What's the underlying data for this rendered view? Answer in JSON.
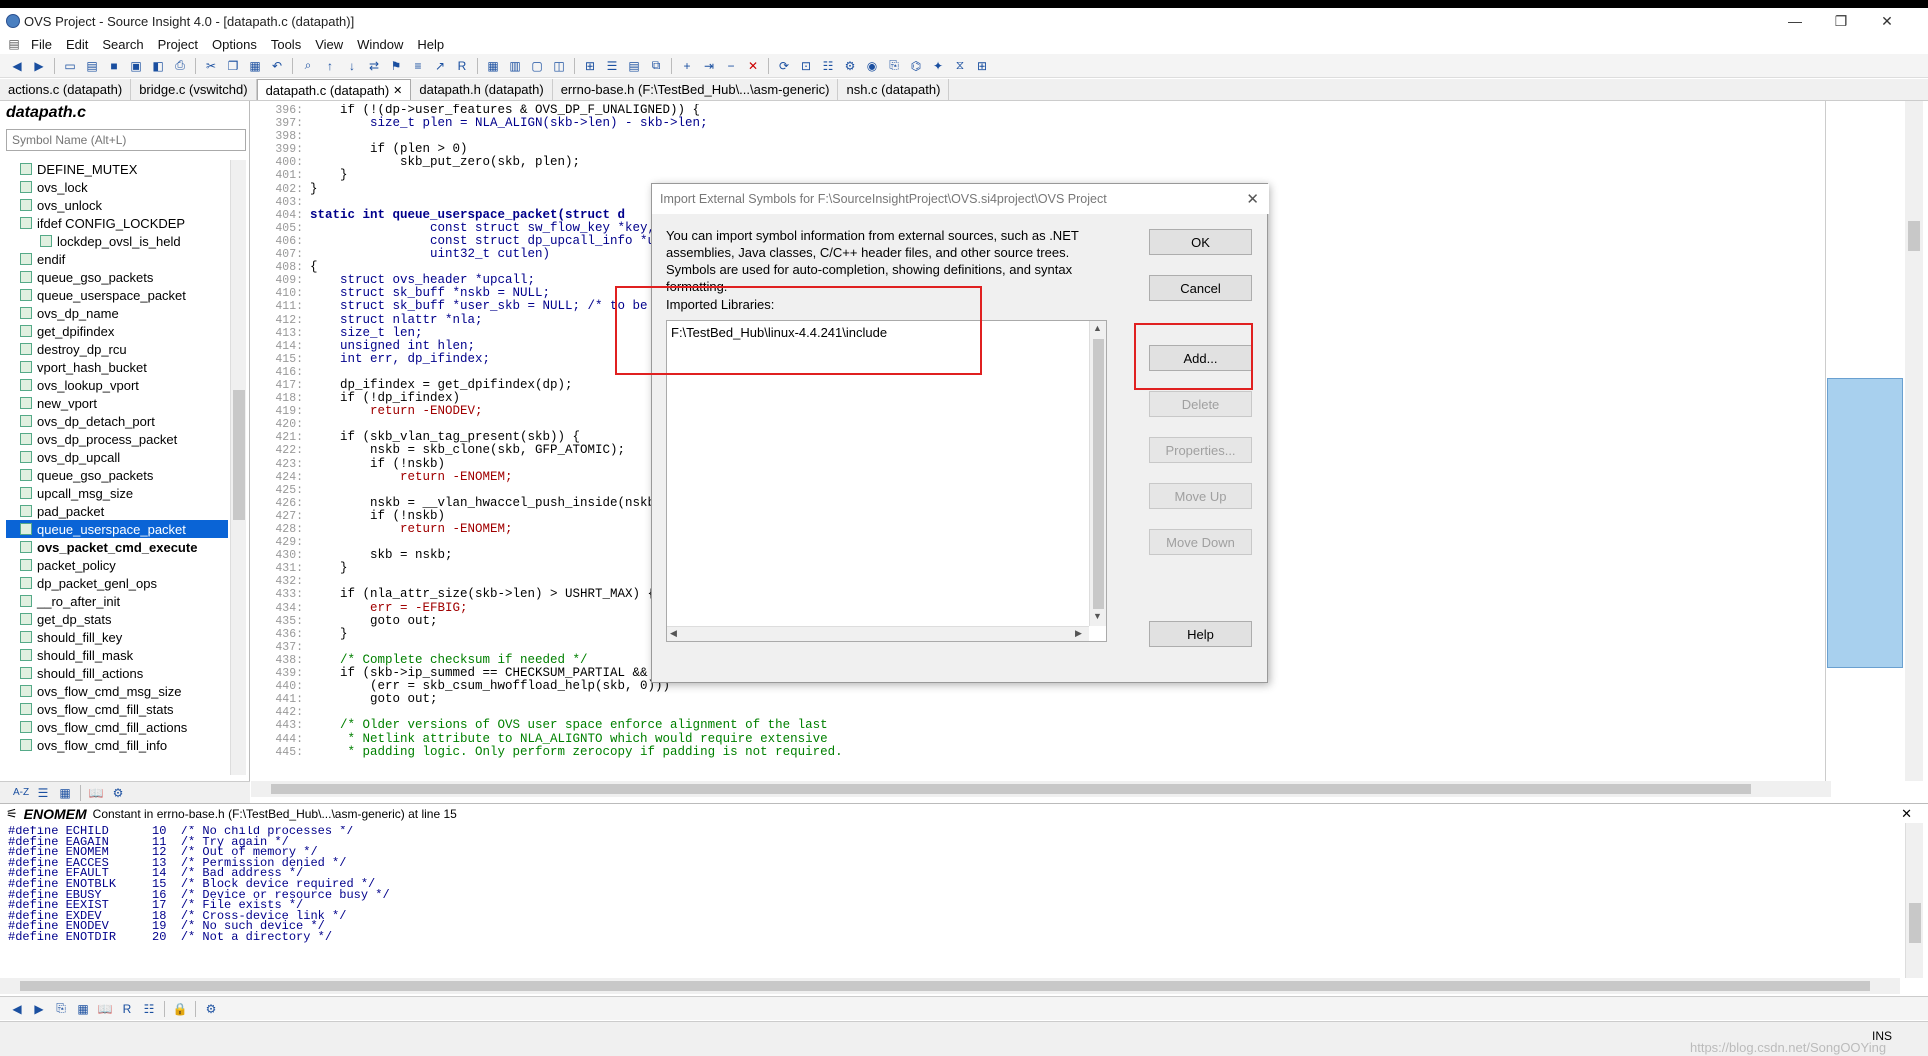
{
  "window": {
    "title": "OVS Project - Source Insight 4.0 - [datapath.c (datapath)]",
    "min": "—",
    "restore": "❐",
    "close": "✕"
  },
  "menu": [
    "File",
    "Edit",
    "Search",
    "Project",
    "Options",
    "Tools",
    "View",
    "Window",
    "Help"
  ],
  "tabs": [
    {
      "label": "actions.c (datapath)",
      "active": false
    },
    {
      "label": "bridge.c (vswitchd)",
      "active": false
    },
    {
      "label": "datapath.c (datapath)",
      "active": true
    },
    {
      "label": "datapath.h (datapath)",
      "active": false
    },
    {
      "label": "errno-base.h (F:\\TestBed_Hub\\...\\asm-generic)",
      "active": false
    },
    {
      "label": "nsh.c (datapath)",
      "active": false
    }
  ],
  "symbol_panel": {
    "title": "datapath.c",
    "search_placeholder": "Symbol Name (Alt+L)",
    "items": [
      {
        "label": "DEFINE_MUTEX",
        "sel": false,
        "bold": false
      },
      {
        "label": "ovs_lock",
        "sel": false,
        "bold": false
      },
      {
        "label": "ovs_unlock",
        "sel": false,
        "bold": false
      },
      {
        "label": "ifdef CONFIG_LOCKDEP",
        "sel": false,
        "bold": false
      },
      {
        "label": "lockdep_ovsl_is_held",
        "sel": false,
        "bold": false
      },
      {
        "label": "endif",
        "sel": false,
        "bold": false
      },
      {
        "label": "queue_gso_packets",
        "sel": false,
        "bold": false
      },
      {
        "label": "queue_userspace_packet",
        "sel": false,
        "bold": false
      },
      {
        "label": "ovs_dp_name",
        "sel": false,
        "bold": false
      },
      {
        "label": "get_dpifindex",
        "sel": false,
        "bold": false
      },
      {
        "label": "destroy_dp_rcu",
        "sel": false,
        "bold": false
      },
      {
        "label": "vport_hash_bucket",
        "sel": false,
        "bold": false
      },
      {
        "label": "ovs_lookup_vport",
        "sel": false,
        "bold": false
      },
      {
        "label": "new_vport",
        "sel": false,
        "bold": false
      },
      {
        "label": "ovs_dp_detach_port",
        "sel": false,
        "bold": false
      },
      {
        "label": "ovs_dp_process_packet",
        "sel": false,
        "bold": false
      },
      {
        "label": "ovs_dp_upcall",
        "sel": false,
        "bold": false
      },
      {
        "label": "queue_gso_packets",
        "sel": false,
        "bold": false
      },
      {
        "label": "upcall_msg_size",
        "sel": false,
        "bold": false
      },
      {
        "label": "pad_packet",
        "sel": false,
        "bold": false
      },
      {
        "label": "queue_userspace_packet",
        "sel": true,
        "bold": false
      },
      {
        "label": "ovs_packet_cmd_execute",
        "sel": false,
        "bold": true
      },
      {
        "label": "packet_policy",
        "sel": false,
        "bold": false
      },
      {
        "label": "dp_packet_genl_ops",
        "sel": false,
        "bold": false
      },
      {
        "label": "__ro_after_init",
        "sel": false,
        "bold": false
      },
      {
        "label": "get_dp_stats",
        "sel": false,
        "bold": false
      },
      {
        "label": "should_fill_key",
        "sel": false,
        "bold": false
      },
      {
        "label": "should_fill_mask",
        "sel": false,
        "bold": false
      },
      {
        "label": "should_fill_actions",
        "sel": false,
        "bold": false
      },
      {
        "label": "ovs_flow_cmd_msg_size",
        "sel": false,
        "bold": false
      },
      {
        "label": "ovs_flow_cmd_fill_stats",
        "sel": false,
        "bold": false
      },
      {
        "label": "ovs_flow_cmd_fill_actions",
        "sel": false,
        "bold": false
      },
      {
        "label": "ovs_flow_cmd_fill_info",
        "sel": false,
        "bold": false
      }
    ]
  },
  "code": {
    "lines": [
      {
        "n": "396:",
        "t": "    if (!(dp->user_features & OVS_DP_F_UNALIGNED)) {"
      },
      {
        "n": "397:",
        "t": "        size_t plen = NLA_ALIGN(skb->len) - skb->len;"
      },
      {
        "n": "398:",
        "t": ""
      },
      {
        "n": "399:",
        "t": "        if (plen > 0)"
      },
      {
        "n": "400:",
        "t": "            skb_put_zero(skb, plen);"
      },
      {
        "n": "401:",
        "t": "    }"
      },
      {
        "n": "402:",
        "t": "}"
      },
      {
        "n": "403:",
        "t": ""
      },
      {
        "n": "404:",
        "t": "static int queue_userspace_packet(struct d"
      },
      {
        "n": "405:",
        "t": "                const struct sw_flow_key *key,"
      },
      {
        "n": "406:",
        "t": "                const struct dp_upcall_info *up"
      },
      {
        "n": "407:",
        "t": "                uint32_t cutlen)"
      },
      {
        "n": "408:",
        "t": "{"
      },
      {
        "n": "409:",
        "t": "    struct ovs_header *upcall;"
      },
      {
        "n": "410:",
        "t": "    struct sk_buff *nskb = NULL;"
      },
      {
        "n": "411:",
        "t": "    struct sk_buff *user_skb = NULL; /* to be que"
      },
      {
        "n": "412:",
        "t": "    struct nlattr *nla;"
      },
      {
        "n": "413:",
        "t": "    size_t len;"
      },
      {
        "n": "414:",
        "t": "    unsigned int hlen;"
      },
      {
        "n": "415:",
        "t": "    int err, dp_ifindex;"
      },
      {
        "n": "416:",
        "t": ""
      },
      {
        "n": "417:",
        "t": "    dp_ifindex = get_dpifindex(dp);"
      },
      {
        "n": "418:",
        "t": "    if (!dp_ifindex)"
      },
      {
        "n": "419:",
        "t": "        return -ENODEV;"
      },
      {
        "n": "420:",
        "t": ""
      },
      {
        "n": "421:",
        "t": "    if (skb_vlan_tag_present(skb)) {"
      },
      {
        "n": "422:",
        "t": "        nskb = skb_clone(skb, GFP_ATOMIC);"
      },
      {
        "n": "423:",
        "t": "        if (!nskb)"
      },
      {
        "n": "424:",
        "t": "            return -ENOMEM;"
      },
      {
        "n": "425:",
        "t": ""
      },
      {
        "n": "426:",
        "t": "        nskb = __vlan_hwaccel_push_inside(nskb);"
      },
      {
        "n": "427:",
        "t": "        if (!nskb)"
      },
      {
        "n": "428:",
        "t": "            return -ENOMEM;"
      },
      {
        "n": "429:",
        "t": ""
      },
      {
        "n": "430:",
        "t": "        skb = nskb;"
      },
      {
        "n": "431:",
        "t": "    }"
      },
      {
        "n": "432:",
        "t": ""
      },
      {
        "n": "433:",
        "t": "    if (nla_attr_size(skb->len) > USHRT_MAX) {"
      },
      {
        "n": "434:",
        "t": "        err = -EFBIG;"
      },
      {
        "n": "435:",
        "t": "        goto out;"
      },
      {
        "n": "436:",
        "t": "    }"
      },
      {
        "n": "437:",
        "t": ""
      },
      {
        "n": "438:",
        "t": "    /* Complete checksum if needed */"
      },
      {
        "n": "439:",
        "t": "    if (skb->ip_summed == CHECKSUM_PARTIAL &&"
      },
      {
        "n": "440:",
        "t": "        (err = skb_csum_hwoffload_help(skb, 0)))"
      },
      {
        "n": "441:",
        "t": "        goto out;"
      },
      {
        "n": "442:",
        "t": ""
      },
      {
        "n": "443:",
        "t": "    /* Older versions of OVS user space enforce alignment of the last"
      },
      {
        "n": "444:",
        "t": "     * Netlink attribute to NLA_ALIGNTO which would require extensive"
      },
      {
        "n": "445:",
        "t": "     * padding logic. Only perform zerocopy if padding is not required."
      }
    ]
  },
  "context": {
    "symbol": "ENOMEM",
    "desc": "Constant in errno-base.h (F:\\TestBed_Hub\\...\\asm-generic) at line 15",
    "lines": [
      "#define ECHILD      10  /* No child processes */",
      "#define EAGAIN      11  /* Try again */",
      "#define ENOMEM      12  /* Out of memory */",
      "#define EACCES      13  /* Permission denied */",
      "#define EFAULT      14  /* Bad address */",
      "#define ENOTBLK     15  /* Block device required */",
      "#define EBUSY       16  /* Device or resource busy */",
      "#define EEXIST      17  /* File exists */",
      "#define EXDEV       18  /* Cross-device link */",
      "#define ENODEV      19  /* No such device */",
      "#define ENOTDIR     20  /* Not a directory */"
    ]
  },
  "dialog": {
    "title": "Import External Symbols for F:\\SourceInsightProject\\OVS.si4project\\OVS Project",
    "description": "You can import symbol information from external sources, such as .NET assemblies, Java classes, C/C++ header files, and other source trees. Symbols are used for auto-completion, showing definitions, and syntax formatting.",
    "libraries_label": "Imported Libraries:",
    "libraries": [
      "F:\\TestBed_Hub\\linux-4.4.241\\include"
    ],
    "buttons": {
      "ok": "OK",
      "cancel": "Cancel",
      "add": "Add...",
      "delete": "Delete",
      "properties": "Properties...",
      "move_up": "Move Up",
      "move_down": "Move Down",
      "help": "Help"
    }
  },
  "status": {
    "mode": "INS",
    "watermark": "https://blog.csdn.net/SongOOYing"
  },
  "colors": {
    "highlight": "#e02020",
    "selection": "#0a64d6"
  }
}
